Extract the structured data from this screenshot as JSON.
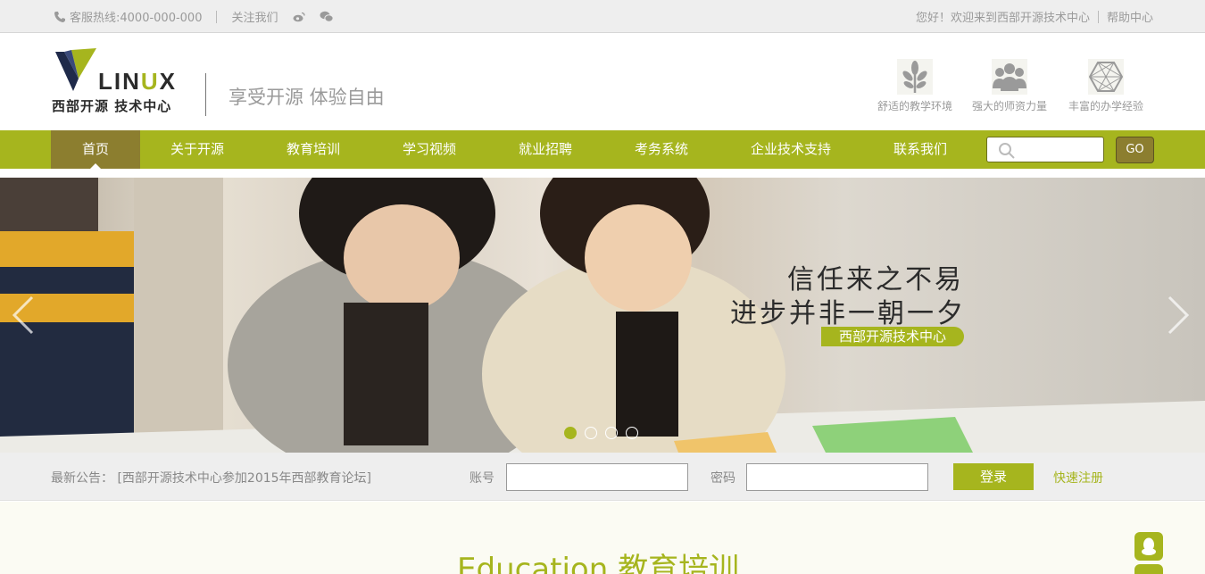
{
  "topbar": {
    "hotline": "客服热线:4000-000-000",
    "follow": "关注我们",
    "welcome": "您好！欢迎来到西部开源技术中心",
    "help": "帮助中心"
  },
  "header": {
    "logo_brand_main": "LIN",
    "logo_brand_accent": "U",
    "logo_brand_tail": "X",
    "logo_cn": "西部开源 技术中心",
    "slogan": "享受开源 体验自由",
    "features": [
      {
        "icon": "leaf-icon",
        "label": "舒适的教学环境"
      },
      {
        "icon": "people-icon",
        "label": "强大的师资力量"
      },
      {
        "icon": "polyhedron-icon",
        "label": "丰富的办学经验"
      }
    ]
  },
  "nav": {
    "items": [
      "首页",
      "关于开源",
      "教育培训",
      "学习视频",
      "就业招聘",
      "考务系统",
      "企业技术支持",
      "联系我们"
    ],
    "active_index": 0,
    "search_placeholder": "",
    "go_label": "GO"
  },
  "banner": {
    "headline_1": "信任来之不易",
    "headline_2": "进步并非一朝一夕",
    "tag": "西部开源技术中心",
    "slide_count": 4,
    "active_slide": 0
  },
  "loginbar": {
    "notice": "最新公告： [西部开源技术中心参加2015年西部教育论坛]",
    "account_label": "账号",
    "account_value": "",
    "password_label": "密码",
    "password_value": "",
    "login_label": "登录",
    "register_label": "快速注册"
  },
  "section": {
    "heading": "Education 教育培训"
  },
  "colors": {
    "accent": "#a6b51e",
    "nav_active": "#8c7e2f"
  }
}
